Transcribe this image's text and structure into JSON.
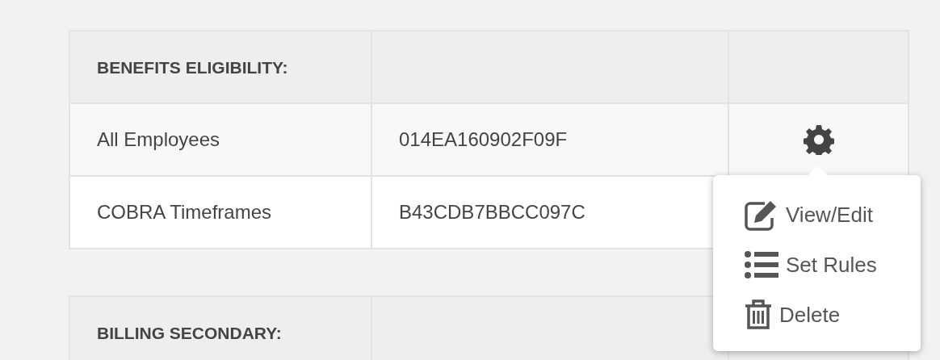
{
  "tables": [
    {
      "title": "BENEFITS ELIGIBILITY:",
      "rows": [
        {
          "name": "All Employees",
          "code": "014EA160902F09F",
          "menu": {
            "items": [
              {
                "kind": "edit",
                "label": "View/Edit"
              },
              {
                "kind": "list",
                "label": "Set Rules"
              },
              {
                "kind": "delete",
                "label": "Delete"
              }
            ]
          }
        },
        {
          "name": "COBRA Timeframes",
          "code": "B43CDB7BBCC097C"
        }
      ]
    },
    {
      "title": "BILLING SECONDARY:"
    }
  ]
}
